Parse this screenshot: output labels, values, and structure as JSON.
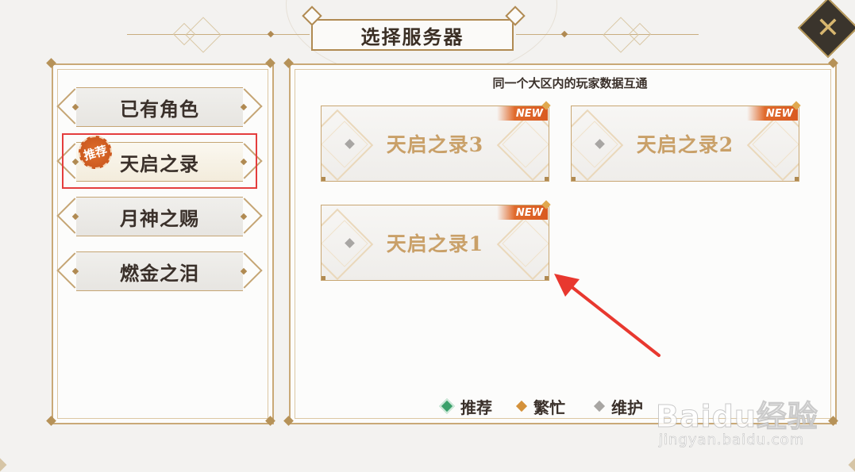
{
  "header": {
    "title": "选择服务器"
  },
  "regions": [
    {
      "label": "已有角色",
      "selected": false
    },
    {
      "label": "天启之录",
      "selected": true,
      "badge": "推荐"
    },
    {
      "label": "月神之赐",
      "selected": false
    },
    {
      "label": "燃金之泪",
      "selected": false
    }
  ],
  "server_panel": {
    "hint": "同一个大区内的玩家数据互通",
    "servers": [
      {
        "name": "天启之录3",
        "tag": "NEW"
      },
      {
        "name": "天启之录2",
        "tag": "NEW"
      },
      {
        "name": "天启之录1",
        "tag": "NEW"
      }
    ]
  },
  "legend": [
    {
      "label": "推荐",
      "color": "#3aa06a"
    },
    {
      "label": "繁忙",
      "color": "#d4913a"
    },
    {
      "label": "维护",
      "color": "#a8a6a3"
    }
  ],
  "watermark": {
    "logo": "Baidu经验",
    "url": "jingyan.baidu.com"
  }
}
